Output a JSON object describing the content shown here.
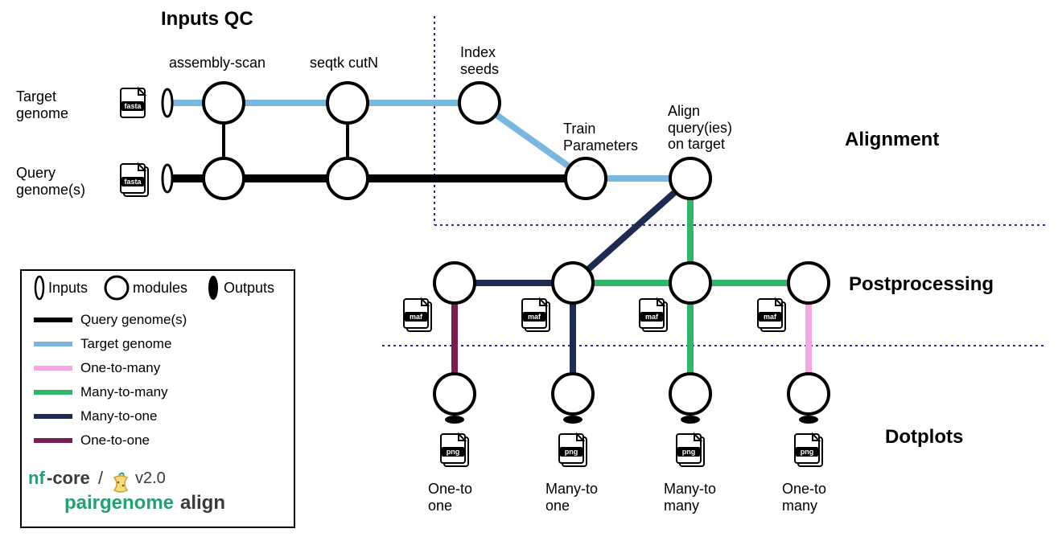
{
  "sections": {
    "inputs_qc": "Inputs QC",
    "alignment": "Alignment",
    "postprocessing": "Postprocessing",
    "dotplots": "Dotplots"
  },
  "inputs": {
    "target": "Target\ngenome",
    "query": "Query\ngenome(s)"
  },
  "nodes": {
    "assembly_scan": "assembly-scan",
    "seqtk_cutn": "seqtk cutN",
    "index_seeds": "Index\nseeds",
    "train_params": "Train\nParameters",
    "align": "Align\nquery(ies)\non target"
  },
  "outputs": {
    "o2o": "One-to\none",
    "m2o": "Many-to\none",
    "m2m": "Many-to\nmany",
    "o2m": "One-to\nmany"
  },
  "file_types": {
    "fasta": "fasta",
    "maf": "maf",
    "png": "png"
  },
  "legend": {
    "inputs": "Inputs",
    "modules": "modules",
    "outputs": "Outputs",
    "query": "Query genome(s)",
    "target": "Target genome",
    "o2m": "One-to-many",
    "m2m": "Many-to-many",
    "m2o": "Many-to-one",
    "o2o": "One-to-one"
  },
  "brand": {
    "nf": "nf",
    "core": "-core",
    "slash": "/",
    "version": "v2.0",
    "pairgenome": "pairgenome",
    "align": "align"
  },
  "colors": {
    "black": "#000000",
    "target_blue": "#79b7e0",
    "o2m_pink": "#f2a7e0",
    "m2m_green": "#31b56b",
    "m2o_navy": "#1d2a52",
    "o2o_maroon": "#7a1d52",
    "brand_green": "#25a06f",
    "brand_dark": "#3a3a3a",
    "dash_blue": "#2e2e8a"
  }
}
